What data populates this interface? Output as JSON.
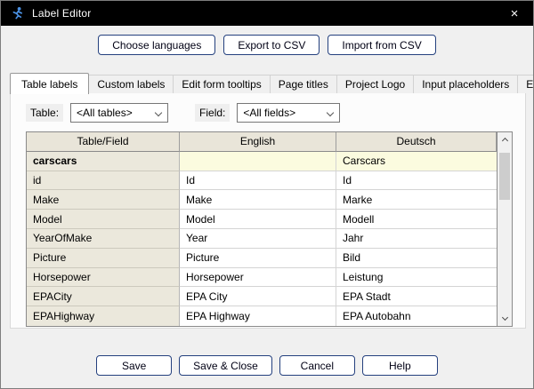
{
  "window": {
    "title": "Label Editor",
    "close_glyph": "×",
    "app_icon": "running-person"
  },
  "toolbar": {
    "choose_languages": "Choose languages",
    "export_csv": "Export to CSV",
    "import_csv": "Import from CSV"
  },
  "tabs": {
    "active": "Table labels",
    "items": [
      "Table labels",
      "Custom labels",
      "Edit form tooltips",
      "Page titles",
      "Project Logo",
      "Input placeholders",
      "EU cookie banner"
    ]
  },
  "filters": {
    "table_label": "Table:",
    "table_value": "<All tables>",
    "field_label": "Field:",
    "field_value": "<All fields>"
  },
  "table": {
    "columns": [
      "Table/Field",
      "English",
      "Deutsch"
    ],
    "rows": [
      {
        "cells": [
          "carscars",
          "",
          "Carscars"
        ],
        "bold": true,
        "highlight": true
      },
      {
        "cells": [
          "id",
          "Id",
          "Id"
        ]
      },
      {
        "cells": [
          "Make",
          "Make",
          "Marke"
        ]
      },
      {
        "cells": [
          "Model",
          "Model",
          "Modell"
        ]
      },
      {
        "cells": [
          "YearOfMake",
          "Year",
          "Jahr"
        ]
      },
      {
        "cells": [
          "Picture",
          "Picture",
          "Bild"
        ]
      },
      {
        "cells": [
          "Horsepower",
          "Horsepower",
          "Leistung"
        ]
      },
      {
        "cells": [
          "EPACity",
          "EPA City",
          "EPA Stadt"
        ]
      },
      {
        "cells": [
          "EPAHighway",
          "EPA Highway",
          "EPA Autobahn"
        ]
      }
    ]
  },
  "footer": {
    "save": "Save",
    "save_close": "Save & Close",
    "cancel": "Cancel",
    "help": "Help"
  },
  "colors": {
    "titlebar_bg": "#000000",
    "dialog_bg": "#f0f0f0",
    "button_border": "#24407e",
    "header_bg": "#e9e5d9",
    "first_col_bg": "#ebe8dc",
    "highlight_row_bg": "#fbfbdf",
    "icon_blue": "#4a90e2"
  }
}
